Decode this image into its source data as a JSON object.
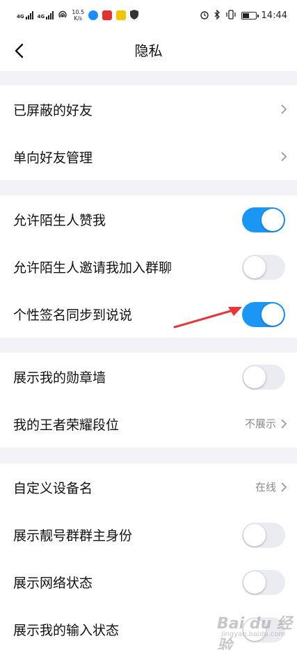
{
  "status_bar": {
    "network_1": "4G",
    "network_2": "4G",
    "speed_value": "10.5",
    "speed_unit": "K/s",
    "time": "14:44",
    "icons": [
      "signal-icon",
      "signal-icon",
      "hotspot-icon",
      "app-icon-blue",
      "app-icon-red",
      "app-icon-yellow",
      "shield-icon",
      "alarm-icon",
      "bluetooth-icon",
      "vibrate-icon",
      "battery-icon"
    ]
  },
  "nav": {
    "title": "隐私",
    "back_icon": "chevron-left-icon"
  },
  "sections": [
    {
      "items": [
        {
          "label": "已屏蔽的好友",
          "type": "link"
        },
        {
          "label": "单向好友管理",
          "type": "link"
        }
      ]
    },
    {
      "items": [
        {
          "label": "允许陌生人赞我",
          "type": "toggle",
          "on": true
        },
        {
          "label": "允许陌生人邀请我加入群聊",
          "type": "toggle",
          "on": false
        },
        {
          "label": "个性签名同步到说说",
          "type": "toggle",
          "on": true
        }
      ]
    },
    {
      "items": [
        {
          "label": "展示我的勋章墙",
          "type": "toggle",
          "on": false
        },
        {
          "label": "我的王者荣耀段位",
          "type": "link",
          "value": "不展示"
        }
      ]
    },
    {
      "items": [
        {
          "label": "自定义设备名",
          "type": "link",
          "value": "在线"
        },
        {
          "label": "展示靓号群群主身份",
          "type": "toggle",
          "on": false
        },
        {
          "label": "展示网络状态",
          "type": "toggle",
          "on": false
        },
        {
          "label": "展示我的输入状态",
          "type": "toggle",
          "on": false
        }
      ]
    }
  ],
  "colors": {
    "toggle_on": "#1c96f5",
    "toggle_off": "#ebebf2",
    "background": "#f2f2f7",
    "annotation_arrow": "#e8353a"
  },
  "watermark": {
    "main": "Bai du 经验",
    "sub": "jingyan.baidu.com"
  }
}
